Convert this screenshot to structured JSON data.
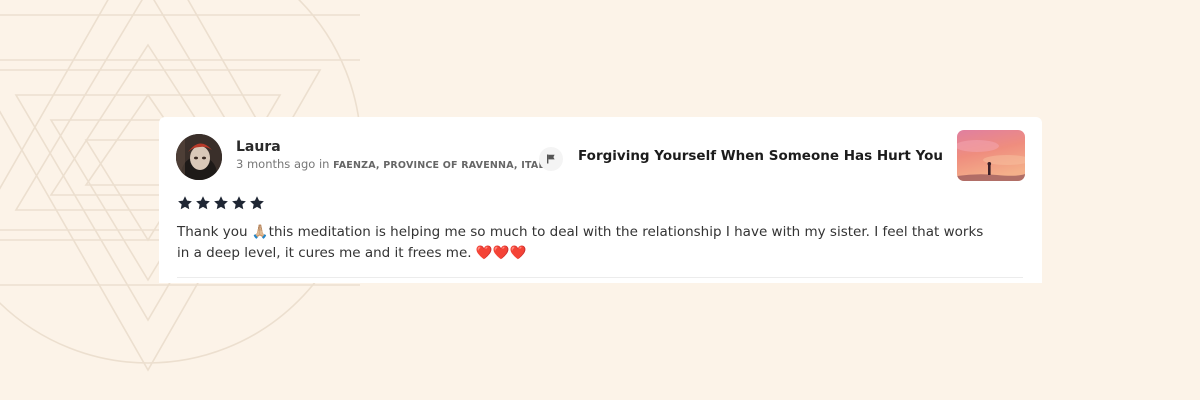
{
  "review": {
    "author": "Laura",
    "time_ago": "3 months ago",
    "in_word": "in",
    "location": "FAENZA, PROVINCE OF RAVENNA, ITALY",
    "rating": 5,
    "text": "Thank you 🙏🏼this meditation is helping me so much to deal with the relationship I have with my sister. I feel that works in a deep level, it cures me and it frees me. ❤️❤️❤️"
  },
  "meditation": {
    "title": "Forgiving Yourself When Someone Has Hurt You"
  },
  "icons": {
    "flag": "flag-icon",
    "star": "star-icon"
  },
  "colors": {
    "background": "#fcf3e8",
    "pattern": "#ecdfcf",
    "star": "#1f2633",
    "card": "#ffffff"
  }
}
